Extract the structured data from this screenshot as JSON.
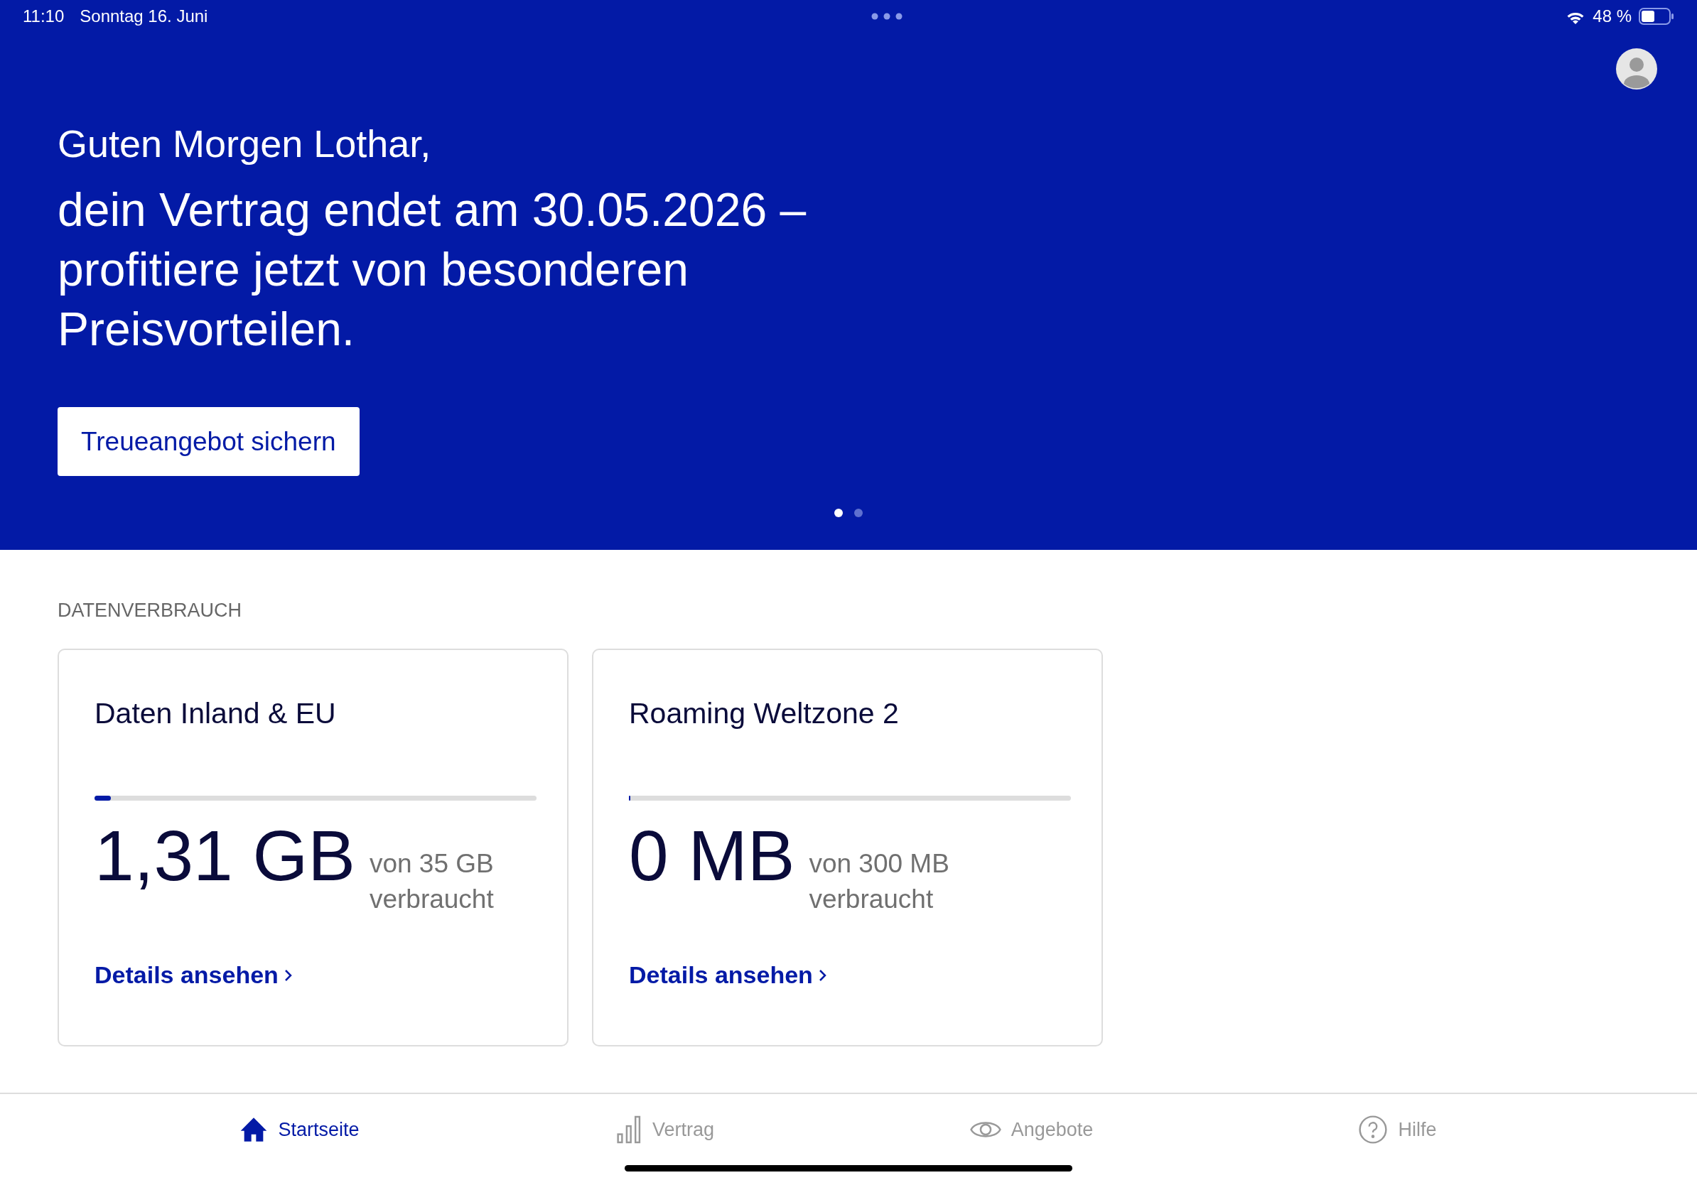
{
  "status_bar": {
    "time": "11:10",
    "date": "Sonntag 16. Juni",
    "battery": "48 %"
  },
  "hero": {
    "greeting": "Guten Morgen Lothar,",
    "headline": "dein Vertrag endet am 30.05.2026 – profitiere jetzt von besonderen Preisvorteilen.",
    "button": "Treueangebot sichern",
    "pages": [
      {
        "selected": true
      },
      {
        "selected": false
      }
    ]
  },
  "data_usage": {
    "title": "DATENVERBRAUCH",
    "cards": [
      {
        "title": "Daten Inland & EU",
        "level": 0.037,
        "used": "1,31 GB",
        "of": "von 35 GB",
        "suffix": "verbraucht",
        "link": "Details ansehen"
      },
      {
        "title": "Roaming Weltzone 2",
        "level": 0,
        "used": "0 MB",
        "of": "von 300 MB",
        "suffix": "verbraucht",
        "link": "Details ansehen"
      }
    ]
  },
  "tab_bar": [
    {
      "kind": "home",
      "label": "Startseite",
      "selected": true
    },
    {
      "kind": "contract",
      "label": "Vertrag",
      "selected": false
    },
    {
      "kind": "offers",
      "label": "Angebote",
      "selected": false
    },
    {
      "kind": "help",
      "label": "Hilfe",
      "selected": false
    }
  ]
}
